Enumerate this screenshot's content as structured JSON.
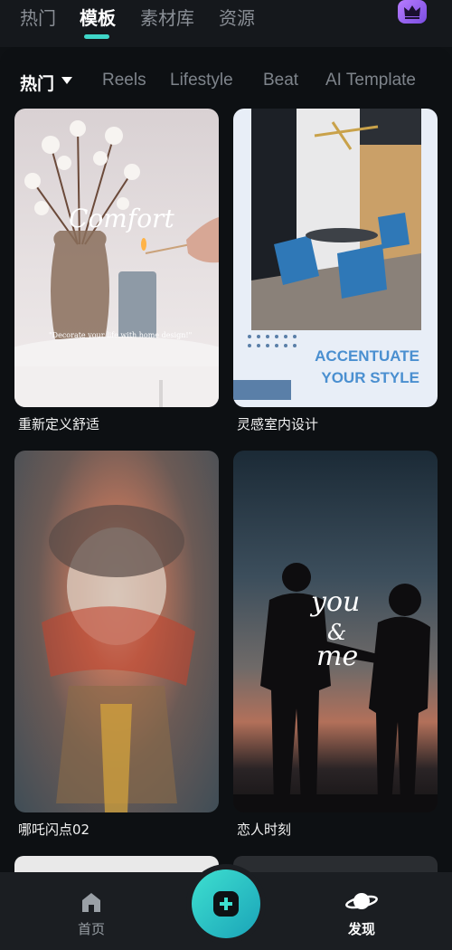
{
  "top_tabs": [
    "热门",
    "模板",
    "素材库",
    "资源"
  ],
  "active_top_tab": "模板",
  "categories": [
    "热门",
    "Reels",
    "Lifestyle",
    "Beat",
    "AI Template"
  ],
  "templates": [
    {
      "title": "重新定义舒适",
      "overlay_text": "Comfort",
      "caption": "\"Decorate your life with home design!\""
    },
    {
      "title": "灵感室内设计",
      "overlay_line1": "ACCENTUATE",
      "overlay_line2": "YOUR STYLE"
    },
    {
      "title": "哪吒闪点02"
    },
    {
      "title": "恋人时刻",
      "overlay_line1": "you",
      "overlay_line2": "&",
      "overlay_line3": "me"
    }
  ],
  "bottom_nav": {
    "home": "首页",
    "discover": "发现"
  },
  "icons": {
    "crown": "crown-icon",
    "caret": "caret-down-icon",
    "home": "home-icon",
    "add": "plus-icon",
    "discover": "planet-icon"
  },
  "colors": {
    "accent": "#3fd6c8",
    "premium": "#9a62f0",
    "card_blue": "#4a8fd0"
  }
}
